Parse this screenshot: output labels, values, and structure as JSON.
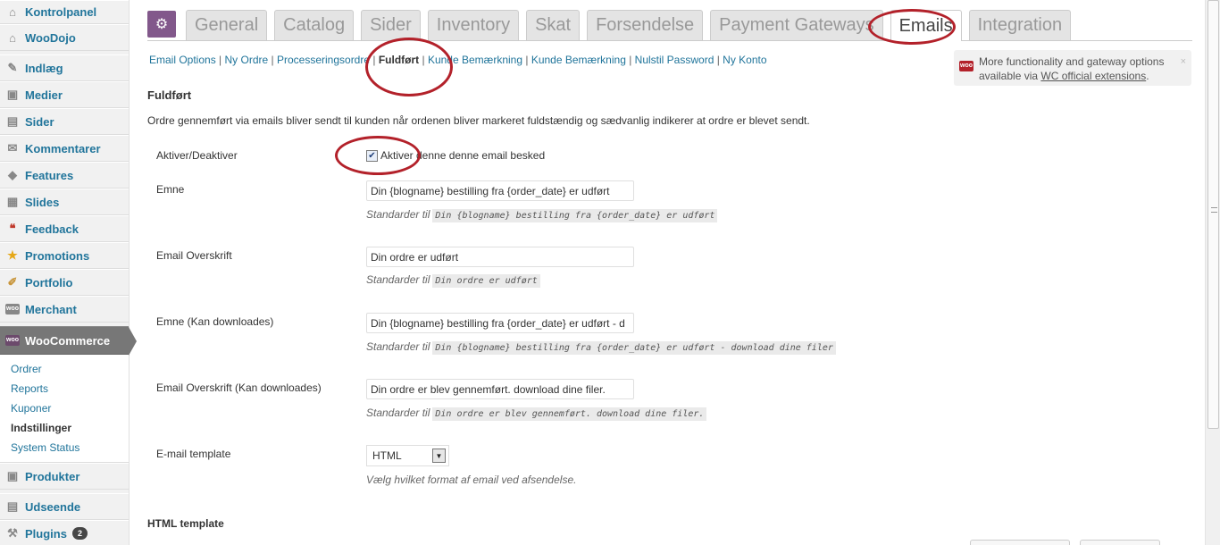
{
  "sidebar": {
    "items": [
      {
        "label": "Kontrolpanel",
        "icon": "dashboard-icon",
        "glyph": "⌂"
      },
      {
        "label": "WooDojo",
        "icon": "woodojo-icon",
        "glyph": "⌂"
      },
      {
        "label": "Indlæg",
        "icon": "pin-icon",
        "glyph": "✎"
      },
      {
        "label": "Medier",
        "icon": "media-icon",
        "glyph": "▣"
      },
      {
        "label": "Sider",
        "icon": "pages-icon",
        "glyph": "▤"
      },
      {
        "label": "Kommentarer",
        "icon": "comment-icon",
        "glyph": "✉"
      },
      {
        "label": "Features",
        "icon": "features-icon",
        "glyph": "◆"
      },
      {
        "label": "Slides",
        "icon": "slides-icon",
        "glyph": "▦"
      },
      {
        "label": "Feedback",
        "icon": "feedback-icon",
        "glyph": "❝"
      },
      {
        "label": "Promotions",
        "icon": "star-icon",
        "glyph": "★"
      },
      {
        "label": "Portfolio",
        "icon": "brush-icon",
        "glyph": "✐"
      },
      {
        "label": "Merchant",
        "icon": "woo-icon",
        "glyph": "woo"
      }
    ],
    "woocommerce": {
      "label": "WooCommerce"
    },
    "submenu": [
      {
        "label": "Ordrer",
        "active": false
      },
      {
        "label": "Reports",
        "active": false
      },
      {
        "label": "Kuponer",
        "active": false
      },
      {
        "label": "Indstillinger",
        "active": true
      },
      {
        "label": "System Status",
        "active": false
      }
    ],
    "bottom_items": [
      {
        "label": "Produkter",
        "icon": "products-icon",
        "glyph": "▣"
      },
      {
        "label": "Udseende",
        "icon": "appearance-icon",
        "glyph": "▤"
      },
      {
        "label": "Plugins",
        "icon": "plugins-icon",
        "glyph": "⚒",
        "badge": "2"
      }
    ]
  },
  "tabs": [
    {
      "label": "General",
      "active": false
    },
    {
      "label": "Catalog",
      "active": false
    },
    {
      "label": "Sider",
      "active": false
    },
    {
      "label": "Inventory",
      "active": false
    },
    {
      "label": "Skat",
      "active": false
    },
    {
      "label": "Forsendelse",
      "active": false
    },
    {
      "label": "Payment Gateways",
      "active": false
    },
    {
      "label": "Emails",
      "active": true
    },
    {
      "label": "Integration",
      "active": false
    }
  ],
  "subsub": [
    {
      "label": "Email Options",
      "current": false
    },
    {
      "label": "Ny Ordre",
      "current": false
    },
    {
      "label": "Processeringsordre",
      "current": false
    },
    {
      "label": "Fuldført",
      "current": true
    },
    {
      "label": "Kunde Bemærkning",
      "current": false
    },
    {
      "label": "Kunde Bemærkning",
      "current": false
    },
    {
      "label": "Nulstil Password",
      "current": false
    },
    {
      "label": "Ny Konto",
      "current": false
    }
  ],
  "notice": {
    "line1": "More functionality and gateway options",
    "prefix": "available via ",
    "link": "WC official extensions",
    "suffix": ".",
    "close": "×"
  },
  "section": {
    "title": "Fuldført",
    "description": "Ordre gennemført via emails bliver sendt til kunden når ordenen bliver markeret fuldstændig og sædvanlig indikerer at ordre er blevet sendt."
  },
  "form": {
    "enable": {
      "label": "Aktiver/Deaktiver",
      "checkbox_label": "Aktiver denne denne email besked",
      "checked": true
    },
    "subject": {
      "label": "Emne",
      "value": "Din {blogname} bestilling fra {order_date} er udført",
      "std_prefix": "Standarder til",
      "std": "Din {blogname} bestilling fra {order_date} er udført"
    },
    "heading": {
      "label": "Email Overskrift",
      "value": "Din ordre er udført",
      "std_prefix": "Standarder til",
      "std": "Din ordre er udført"
    },
    "subject_dl": {
      "label": "Emne (Kan downloades)",
      "value": "Din {blogname} bestilling fra {order_date} er udført - d",
      "std_prefix": "Standarder til",
      "std": "Din {blogname} bestilling fra {order_date} er udført - download dine filer"
    },
    "heading_dl": {
      "label": "Email Overskrift (Kan downloades)",
      "value": "Din ordre er blev gennemført. download dine filer.",
      "std_prefix": "Standarder til",
      "std": "Din ordre er blev gennemført. download dine filer."
    },
    "template": {
      "label": "E-mail template",
      "value": "HTML",
      "help": "Vælg hvilket format af email ved afsendelse."
    }
  },
  "html_template": {
    "title": "HTML template"
  },
  "colors": {
    "accent": "#82588b",
    "link": "#21759b",
    "highlight": "#b3212a"
  }
}
